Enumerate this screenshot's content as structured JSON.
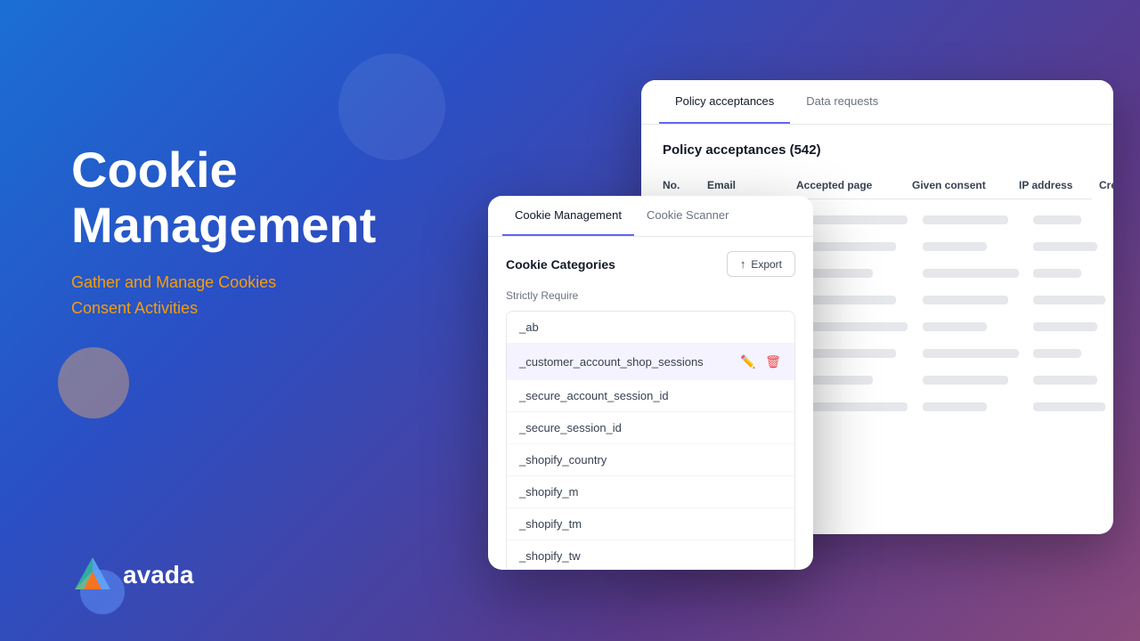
{
  "background": {
    "gradient_start": "#1a6fd4",
    "gradient_end": "#8a4a7c"
  },
  "hero": {
    "title_line1": "Cookie",
    "title_line2": "Management",
    "subtitle_line1": "Gather and Manage Cookies",
    "subtitle_line2": "Consent Activities"
  },
  "logo": {
    "text": "avada"
  },
  "policy_card": {
    "tabs": [
      {
        "label": "Policy acceptances",
        "active": true
      },
      {
        "label": "Data requests",
        "active": false
      }
    ],
    "heading": "Policy acceptances (542)",
    "table_headers": [
      "No.",
      "Email",
      "Accepted page",
      "Given consent",
      "IP address",
      "Created at"
    ],
    "skeleton_rows": 8
  },
  "cookie_card": {
    "tabs": [
      {
        "label": "Cookie Management",
        "active": true
      },
      {
        "label": "Cookie Scanner",
        "active": false
      }
    ],
    "categories_title": "Cookie Categories",
    "export_label": "Export",
    "strictly_require_label": "Strictly Require",
    "cookie_items": [
      {
        "name": "_ab",
        "highlighted": false
      },
      {
        "name": "_customer_account_shop_sessions",
        "highlighted": true
      },
      {
        "name": "_secure_account_session_id",
        "highlighted": false
      },
      {
        "name": "_secure_session_id",
        "highlighted": false
      },
      {
        "name": "_shopify_country",
        "highlighted": false
      },
      {
        "name": "_shopify_m",
        "highlighted": false
      },
      {
        "name": "_shopify_tm",
        "highlighted": false
      },
      {
        "name": "_shopify_tw",
        "highlighted": false
      }
    ]
  }
}
